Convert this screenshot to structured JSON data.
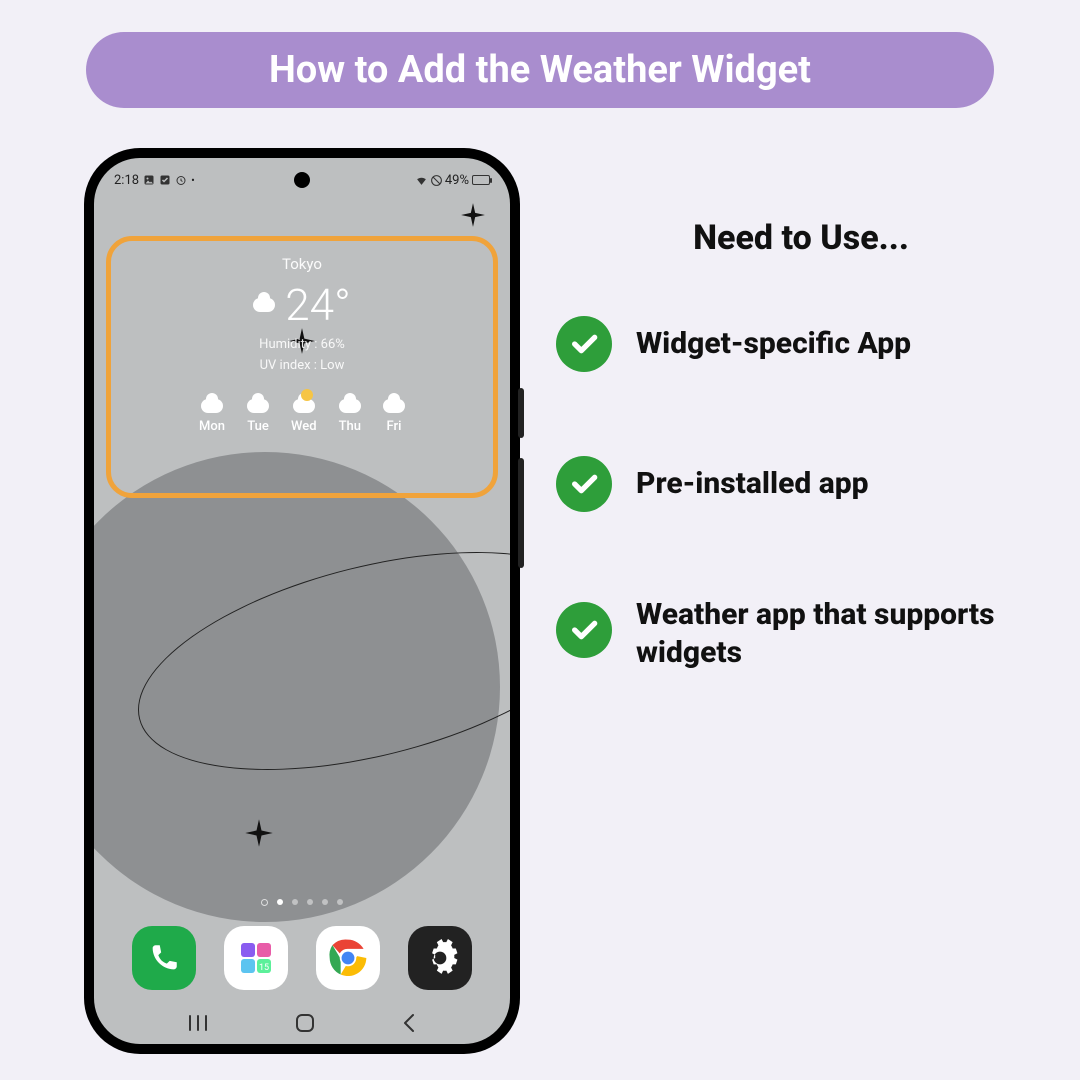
{
  "title": "How to Add the Weather Widget",
  "right": {
    "heading": "Need to Use...",
    "items": [
      "Widget-specific App",
      "Pre-installed app",
      "Weather app that supports widgets"
    ]
  },
  "phone": {
    "status": {
      "time": "2:18",
      "battery_text": "49%"
    },
    "widget": {
      "city": "Tokyo",
      "temp": "24°",
      "humidity": "Humidity : 66%",
      "uv": "UV index : Low",
      "days": [
        "Mon",
        "Tue",
        "Wed",
        "Thu",
        "Fri"
      ]
    },
    "dock": [
      "Phone",
      "Widgets",
      "Chrome",
      "Settings"
    ]
  },
  "colors": {
    "pill": "#a98dce",
    "highlight": "#f0a33b",
    "check": "#2e9e3a"
  }
}
